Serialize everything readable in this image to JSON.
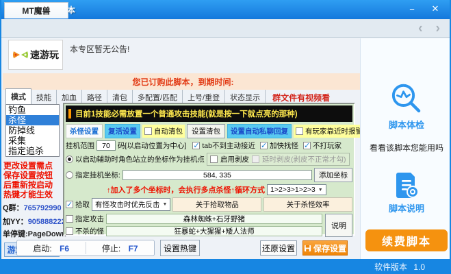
{
  "window": {
    "title": "速游玩-已加载脚本"
  },
  "icons": {
    "minimize": "−",
    "close": "✕",
    "nav_left": "‹",
    "nav_right": "›",
    "dropdown_arrow": "▼"
  },
  "tabstrip": {
    "tab": "MT魔兽"
  },
  "header": {
    "logo_text": "速游玩",
    "announcement": "本专区暂无公告!",
    "subscription": "您已订购此脚本，到期时间:"
  },
  "tabs": [
    "模式",
    "技能",
    "加血",
    "路径",
    "清包",
    "多配置/匹配",
    "上号/重登",
    "状态显示"
  ],
  "tabs_note": "群文件有视频看",
  "sidebar": {
    "modes": [
      "钓鱼",
      "杀怪",
      "防掉线",
      "采集",
      "指定追杀"
    ],
    "warning_lines": [
      "更改设置需点",
      "保存设置按钮",
      "后重新按启动",
      "热键才能生效"
    ],
    "qq_label": "Q群：",
    "qq": "765792990",
    "yy_label": "加YY：",
    "yy": "905888222",
    "stop_key_label": "单停键:",
    "stop_key": "PageDown",
    "screen_button": "游戏画面设置"
  },
  "main": {
    "marquee": "目前1技能必需放置一个普通攻击技能(就是按一下就点亮的那种)",
    "row1": {
      "kill_settings": "杀怪设置",
      "revive_settings": "复活设置",
      "auto_clear_bag": "自动清包",
      "set_clear_bag": "设置清包",
      "auto_reply": "设置自动私聊回复",
      "player_alarm": "有玩家靠近时报警"
    },
    "row2": {
      "range_label": "挂机范围",
      "range_value": "70",
      "range_suffix": "码[以启动位置为中心]",
      "tab_approach": "tab不到主动接近",
      "fast_find": "加快找怪",
      "no_attack_players": "不打玩家"
    },
    "row3": {
      "radio_start_pos": "以启动辅助时角色站立的坐标作为挂机点",
      "skinning": "启用剥皮",
      "delay_skinning": "延时剥皮(剥皮不正常才勾)"
    },
    "row4": {
      "radio_custom_pos": "指定挂机坐标:",
      "coords": "584, 335",
      "add_coord": "添加坐标"
    },
    "row5": {
      "note": "↑加入了多个坐标时，会执行多点杀怪↑循环方式",
      "loop_mode": "1>2>3>1>2>3"
    },
    "row6": {
      "pickup": "拾取",
      "counter_mode": "有怪攻击时优先反击",
      "about_pickup": "关于拾取物品",
      "about_efficiency": "关于杀怪效率"
    },
    "row7": {
      "target_attack": "指定攻击",
      "target_value": "森林蜘蛛+石牙野猪"
    },
    "row8": {
      "no_kill": "不杀的怪",
      "no_kill_value": "狂暴蛇+大猩猩+矮人法师"
    },
    "help_button": "说明"
  },
  "bottombar": {
    "start_label": "启动:",
    "start_key": "F6",
    "stop_label": "停止:",
    "stop_key": "F7",
    "set_hotkey": "设置热键",
    "restore": "还原设置",
    "save": "保存设置"
  },
  "rightbar": {
    "checkup": "脚本体检",
    "checkup_hint": "看看该脚本您能用吗",
    "manual": "脚本说明",
    "renew": "续费脚本",
    "version_label": "软件版本",
    "version": "1.0"
  }
}
